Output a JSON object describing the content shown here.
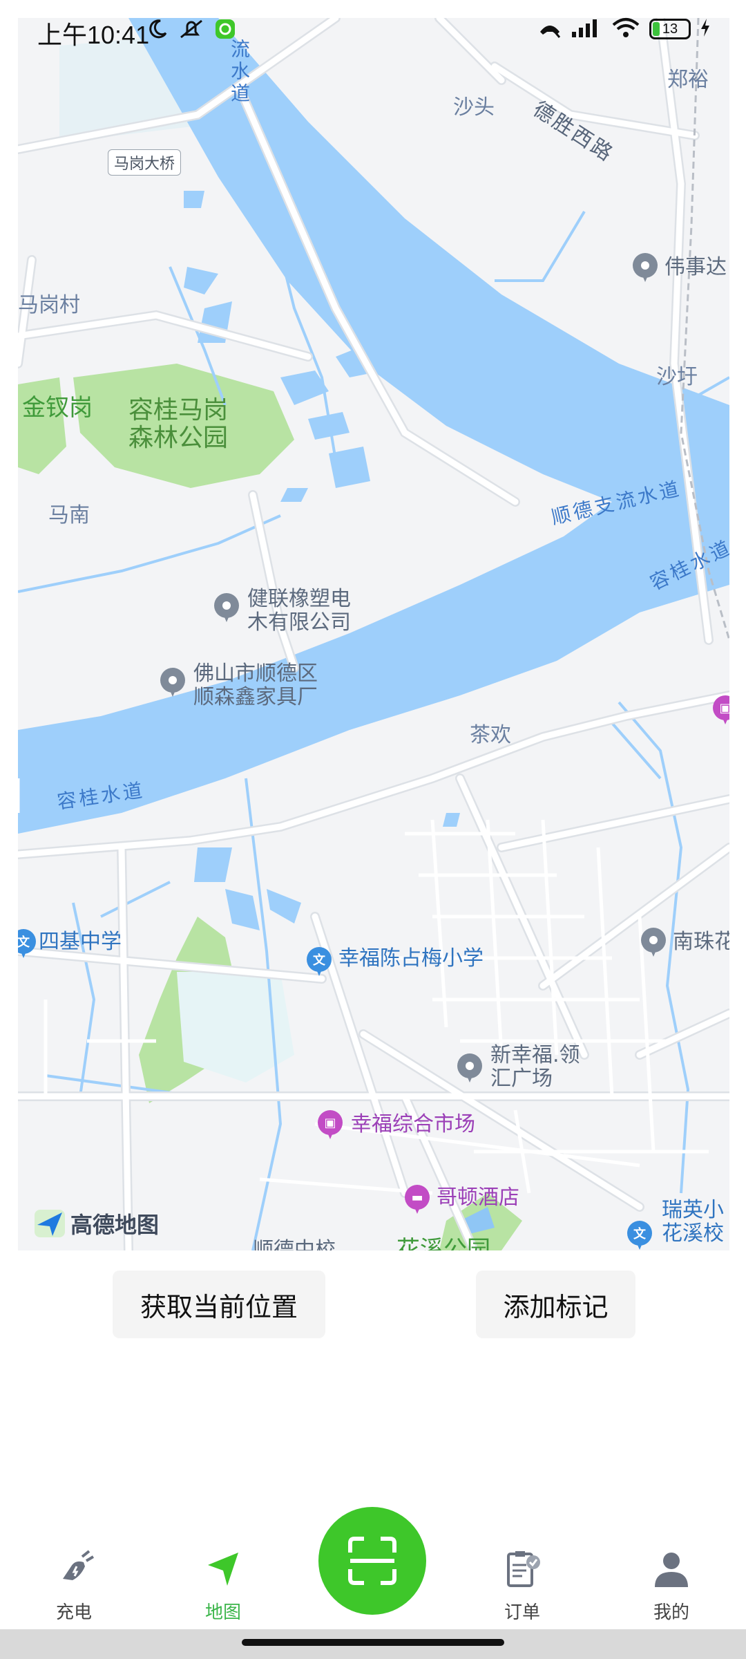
{
  "status_bar": {
    "time": "上午10:41",
    "battery": "13"
  },
  "map": {
    "labels": {
      "shuidao_top": "流水道",
      "zhengyu": "郑裕",
      "shatou": "沙头",
      "deshengxilu": "德胜西路",
      "magang_bridge": "马岗大桥",
      "weishida": "伟事达",
      "magangcun": "马岗村",
      "shawei": "沙圩",
      "jinchagang": "金钗岗",
      "park": "容桂马岗\n森林公园",
      "shunde_river": "顺德支流水道",
      "manan": "马南",
      "ronggui_right": "容桂水道",
      "jianlian": "健联橡塑电\n木有限公司",
      "shunsenxin": "佛山市顺德区\n顺森鑫家具厂",
      "chahuan": "茶欢",
      "ronggui_left": "容桂水道",
      "siji": "四基中学",
      "nanzhu": "南珠花",
      "xingfu_school": "幸福陈占梅小学",
      "xinxingfu": "新幸福.领\n汇广场",
      "market": "幸福综合市场",
      "hotel": "哥顿酒店",
      "ruiying": "瑞英小\n花溪校",
      "bottom_a": "顺德中校",
      "bottom_b": "花溪公园"
    },
    "logo_text": "高德地图"
  },
  "actions": {
    "location_label": "获取当前位置",
    "marker_label": "添加标记"
  },
  "nav": {
    "items": [
      {
        "label": "充电"
      },
      {
        "label": "地图"
      },
      {
        "label": "订单"
      },
      {
        "label": "我的"
      }
    ],
    "scan_icon": "scan-icon"
  },
  "colors": {
    "water": "#9ecffb",
    "park": "#b8e3a3",
    "accent_green": "#3ec72a"
  }
}
